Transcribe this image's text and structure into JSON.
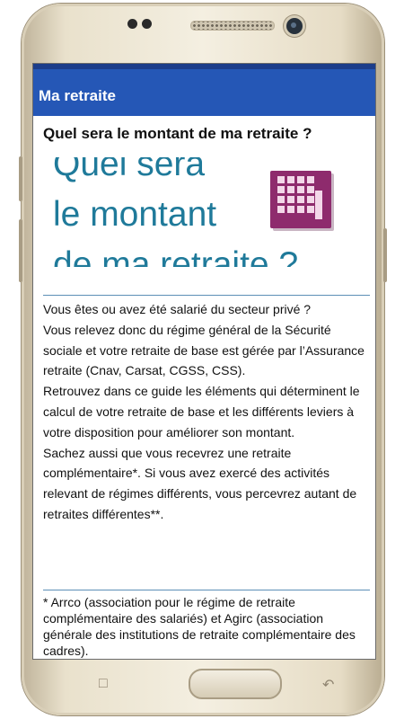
{
  "app": {
    "title": "Ma retraite"
  },
  "page": {
    "heading": "Quel sera le montant de ma retraite ?"
  },
  "hero": {
    "lines": [
      "Quel sera",
      "le montant",
      "de ma retraite ?"
    ],
    "icon": "calculator-icon"
  },
  "body": {
    "paragraphs": [
      "Vous êtes ou avez été salarié du secteur privé ?",
      "Vous relevez donc du régime général de la Sécurité sociale et votre retraite de base est gérée par l’Assurance retraite (Cnav, Carsat, CGSS, CSS).",
      "Retrouvez dans ce guide les éléments qui déterminent le calcul de votre retraite de base et les différents leviers à votre disposition pour améliorer son montant.",
      "Sachez aussi que vous recevrez une retraite complémentaire*. Si vous avez exercé des activités relevant de régimes différents, vous percevrez autant de retraites différentes**."
    ]
  },
  "footnote": {
    "text": "* Arrco (association pour le régime de retraite complémentaire des salariés) et Agirc (association générale des institutions de retraite complémentaire des cadres)."
  },
  "colors": {
    "appbar": "#2557b6",
    "hero_text": "#1f7a9a",
    "calculator": "#8e2b6d",
    "rule": "#5c8fb6"
  }
}
